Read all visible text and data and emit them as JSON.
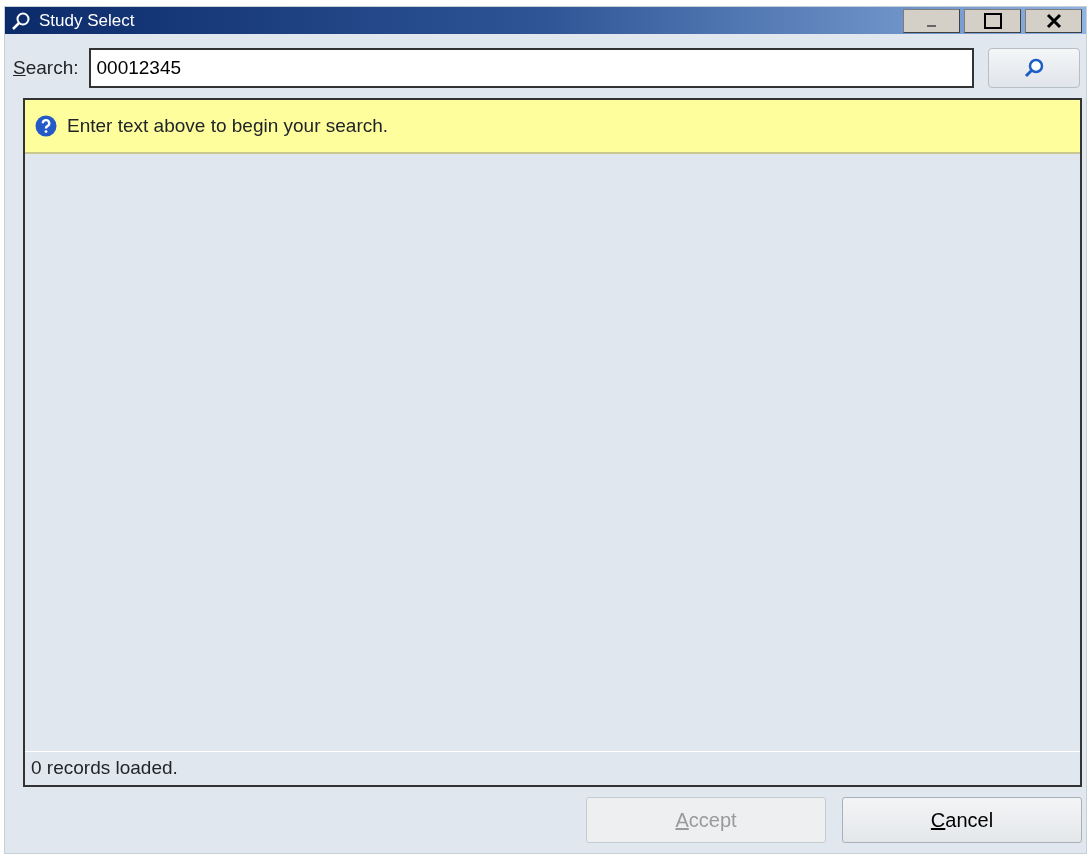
{
  "window": {
    "title": "Study Select"
  },
  "search": {
    "label": "Search:",
    "value": "00012345"
  },
  "info": {
    "text": "Enter text above to begin your search."
  },
  "status_bar": {
    "text": "0 records loaded."
  },
  "buttons": [
    {
      "label": "Accept",
      "disabled": true
    },
    {
      "label": "Cancel",
      "disabled": false
    }
  ]
}
